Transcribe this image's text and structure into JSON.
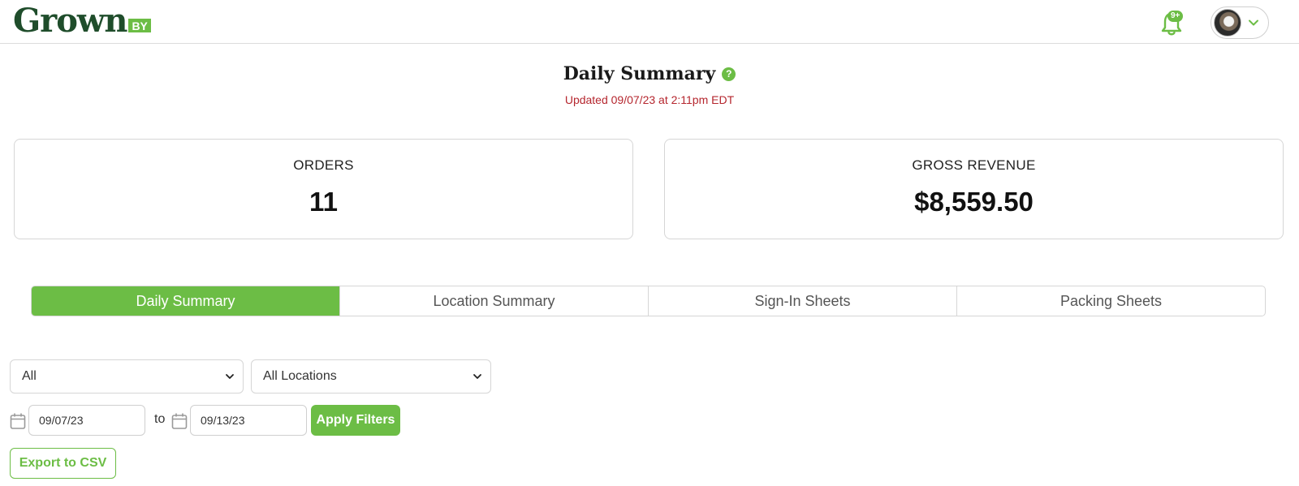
{
  "header": {
    "logo_word": "Grown",
    "logo_suffix": "BY",
    "notifications_badge": "9+",
    "icons": {
      "bell": "bell-icon",
      "chevron": "chevron-down-icon",
      "help": "question-circle-icon",
      "calendar": "calendar-icon"
    },
    "brand_color": "#6cbd45",
    "logo_color": "#1f4d2b"
  },
  "page": {
    "title": "Daily Summary",
    "updated": "Updated 09/07/23 at 2:11pm EDT",
    "updated_color": "#b5262e"
  },
  "stats": {
    "orders_label": "ORDERS",
    "orders_value": "11",
    "revenue_label": "GROSS REVENUE",
    "revenue_value": "$8,559.50"
  },
  "tabs": [
    {
      "label": "Daily Summary",
      "active": true
    },
    {
      "label": "Location Summary",
      "active": false
    },
    {
      "label": "Sign-In Sheets",
      "active": false
    },
    {
      "label": "Packing Sheets",
      "active": false
    }
  ],
  "filters": {
    "status_selected": "All",
    "location_selected": "All Locations",
    "date_from": "09/07/23",
    "to_label": "to",
    "date_to": "09/13/23",
    "apply_label": "Apply Filters",
    "export_label": "Export to CSV"
  }
}
